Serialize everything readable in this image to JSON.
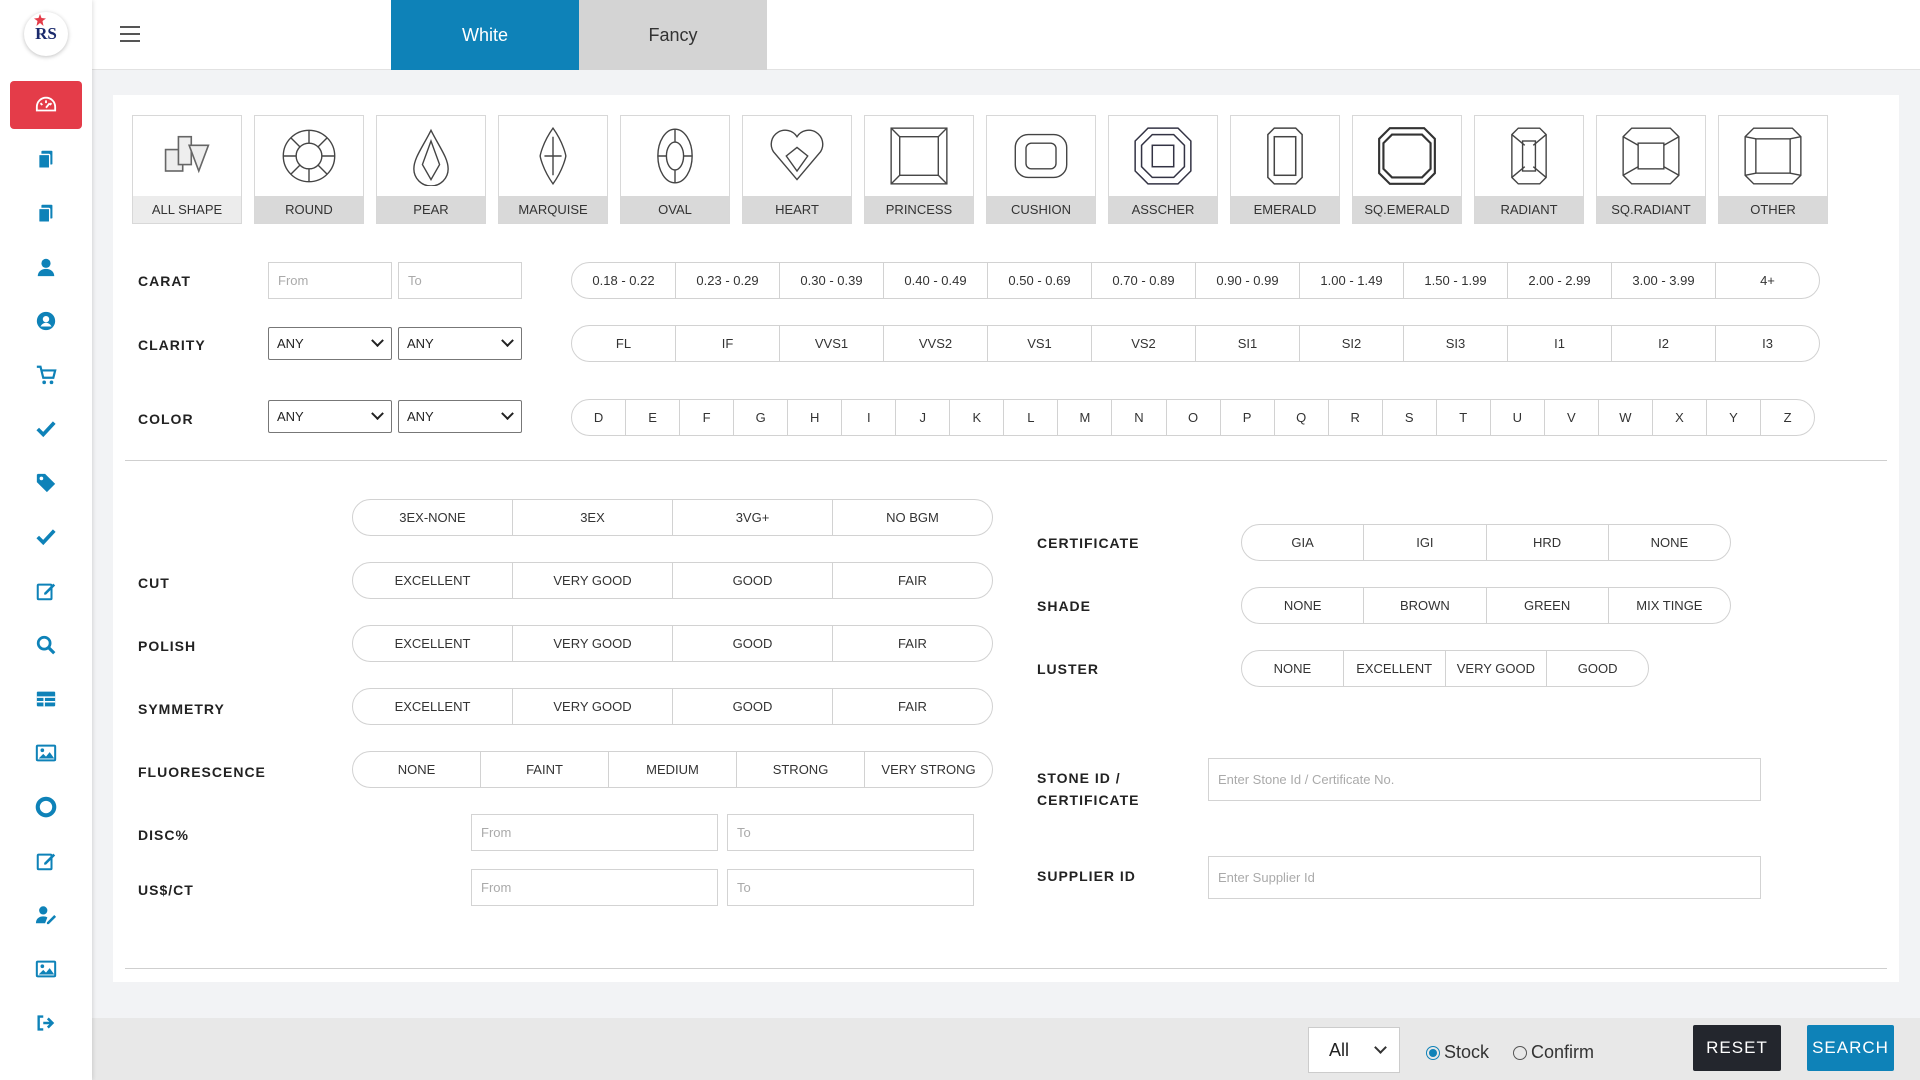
{
  "logo": {
    "text": "RS"
  },
  "sidebar": {
    "items": [
      {
        "name": "dashboard-icon",
        "color": "#ffffff",
        "active": true
      },
      {
        "name": "copy-icon",
        "color": "#0e82b8"
      },
      {
        "name": "copy-icon",
        "color": "#0e82b8"
      },
      {
        "name": "user-icon",
        "color": "#0e82b8"
      },
      {
        "name": "user-circle-icon",
        "color": "#0e82b8"
      },
      {
        "name": "cart-icon",
        "color": "#0e82b8"
      },
      {
        "name": "check-icon",
        "color": "#0e82b8"
      },
      {
        "name": "tag-icon",
        "color": "#0e82b8"
      },
      {
        "name": "check-icon",
        "color": "#0e82b8"
      },
      {
        "name": "edit-icon",
        "color": "#0e82b8"
      },
      {
        "name": "search-icon",
        "color": "#0e82b8"
      },
      {
        "name": "table-icon",
        "color": "#0e82b8"
      },
      {
        "name": "image-icon",
        "color": "#0e82b8"
      },
      {
        "name": "lifebuoy-icon",
        "color": "#0e82b8"
      },
      {
        "name": "edit-icon",
        "color": "#0e82b8"
      },
      {
        "name": "user-edit-icon",
        "color": "#0e82b8"
      },
      {
        "name": "image-icon",
        "color": "#0e82b8"
      },
      {
        "name": "logout-icon",
        "color": "#0e82b8"
      }
    ]
  },
  "tabs": {
    "white": "White",
    "fancy": "Fancy"
  },
  "shapes": [
    "ALL SHAPE",
    "ROUND",
    "PEAR",
    "MARQUISE",
    "OVAL",
    "HEART",
    "PRINCESS",
    "CUSHION",
    "ASSCHER",
    "EMERALD",
    "SQ.EMERALD",
    "RADIANT",
    "SQ.RADIANT",
    "OTHER"
  ],
  "carat": {
    "label": "CARAT",
    "from_placeholder": "From",
    "to_placeholder": "To",
    "ranges": [
      "0.18 - 0.22",
      "0.23 - 0.29",
      "0.30 - 0.39",
      "0.40 - 0.49",
      "0.50 - 0.69",
      "0.70 - 0.89",
      "0.90 - 0.99",
      "1.00 - 1.49",
      "1.50 - 1.99",
      "2.00 - 2.99",
      "3.00 - 3.99",
      "4+"
    ]
  },
  "clarity": {
    "label": "CLARITY",
    "from_value": "ANY",
    "to_value": "ANY",
    "options": [
      "FL",
      "IF",
      "VVS1",
      "VVS2",
      "VS1",
      "VS2",
      "SI1",
      "SI2",
      "SI3",
      "I1",
      "I2",
      "I3"
    ]
  },
  "color": {
    "label": "COLOR",
    "from_value": "ANY",
    "to_value": "ANY",
    "options": [
      "D",
      "E",
      "F",
      "G",
      "H",
      "I",
      "J",
      "K",
      "L",
      "M",
      "N",
      "O",
      "P",
      "Q",
      "R",
      "S",
      "T",
      "U",
      "V",
      "W",
      "X",
      "Y",
      "Z"
    ]
  },
  "presets": [
    "3EX-NONE",
    "3EX",
    "3VG+",
    "NO BGM"
  ],
  "cut": {
    "label": "CUT",
    "options": [
      "EXCELLENT",
      "VERY GOOD",
      "GOOD",
      "FAIR"
    ]
  },
  "polish": {
    "label": "POLISH",
    "options": [
      "EXCELLENT",
      "VERY GOOD",
      "GOOD",
      "FAIR"
    ]
  },
  "symmetry": {
    "label": "SYMMETRY",
    "options": [
      "EXCELLENT",
      "VERY GOOD",
      "GOOD",
      "FAIR"
    ]
  },
  "fluorescence": {
    "label": "FLUORESCENCE",
    "options": [
      "NONE",
      "FAINT",
      "MEDIUM",
      "STRONG",
      "VERY STRONG"
    ]
  },
  "disc": {
    "label": "DISC%",
    "from_placeholder": "From",
    "to_placeholder": "To"
  },
  "usct": {
    "label": "US$/CT",
    "from_placeholder": "From",
    "to_placeholder": "To"
  },
  "certificate": {
    "label": "CERTIFICATE",
    "options": [
      "GIA",
      "IGI",
      "HRD",
      "NONE"
    ]
  },
  "shade": {
    "label": "SHADE",
    "options": [
      "NONE",
      "BROWN",
      "GREEN",
      "MIX TINGE"
    ]
  },
  "luster": {
    "label": "LUSTER",
    "options": [
      "NONE",
      "EXCELLENT",
      "VERY GOOD",
      "GOOD"
    ]
  },
  "stone_id": {
    "label_line1": "STONE ID /",
    "label_line2": "CERTIFICATE",
    "placeholder": "Enter Stone Id / Certificate No."
  },
  "supplier_id": {
    "label": "SUPPLIER ID",
    "placeholder": "Enter Supplier Id"
  },
  "footer": {
    "select_value": "All",
    "radio_stock": "Stock",
    "radio_confirm": "Confirm",
    "stock_checked": true,
    "reset_label": "RESET",
    "search_label": "SEARCH"
  },
  "colors": {
    "accent": "#0e82b8",
    "active_red": "#e43c49",
    "dark": "#23262d"
  }
}
